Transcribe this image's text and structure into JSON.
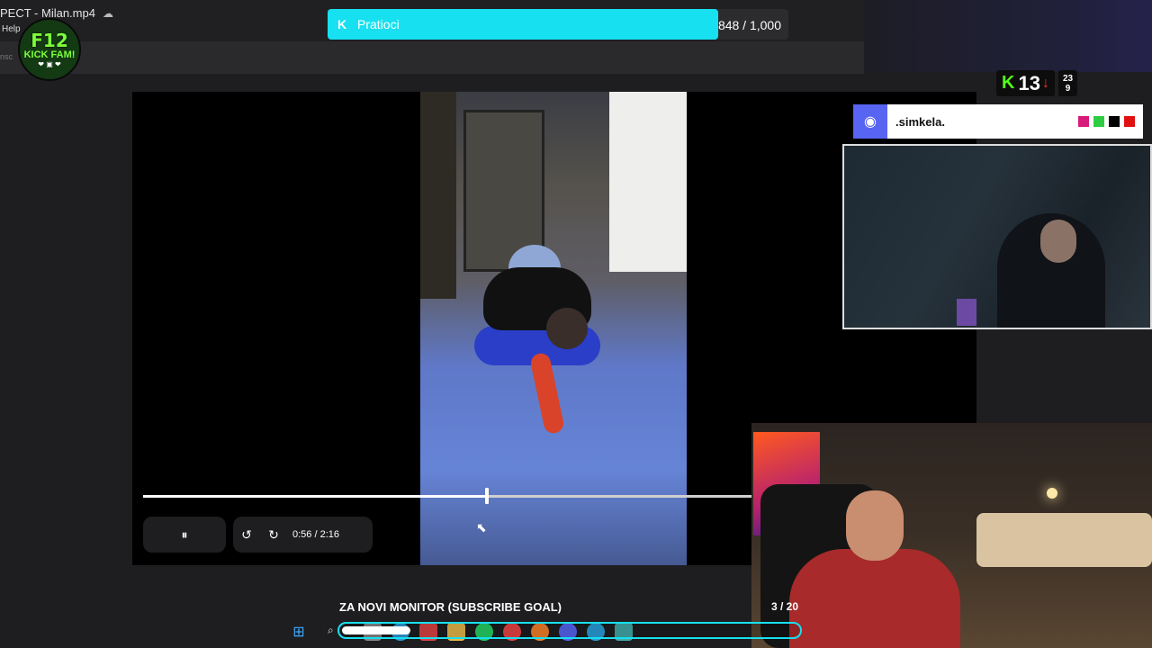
{
  "window": {
    "title": "PECT - Milan.mp4",
    "cloud_icon": "cloud-sync-icon",
    "menu_help": "Help",
    "sub_text": "nsc"
  },
  "logo": {
    "line1": "F12",
    "line2": "KICK FAM!",
    "line3": "❤ ▣ ❤"
  },
  "goal": {
    "icon": "kick-logo-icon",
    "label": "Pratioci",
    "count": "848 / 1,000",
    "progress": 0.848,
    "color": "#17e0f0"
  },
  "player": {
    "time_current": "0:56",
    "time_total": "2:16",
    "time_sep": " / ",
    "progress": 0.412,
    "pause_icon": "⏸",
    "rewind_icon": "↺",
    "forward_icon": "↻"
  },
  "kick_stats": {
    "viewers": "13",
    "trend": "↓",
    "followers_top": "23",
    "followers_bottom": "9",
    "accent": "#53fc18"
  },
  "discord": {
    "username": ".simkela.",
    "colors": [
      "#d81b7a",
      "#2ecc40",
      "#000000",
      "#e01010"
    ]
  },
  "subgoal": {
    "title": "ZA NOVI MONITOR (SUBSCRIBE GOAL)",
    "count": "3 / 20",
    "progress": 0.15
  },
  "taskbar": {
    "icons": [
      "windows-start-icon",
      "search-icon",
      "file-explorer-icon",
      "edge-icon",
      "store-icon",
      "folder-icon",
      "whatsapp-icon",
      "chrome-icon",
      "firefox-icon",
      "discord-icon",
      "telegram-icon",
      "notepad-icon"
    ]
  }
}
